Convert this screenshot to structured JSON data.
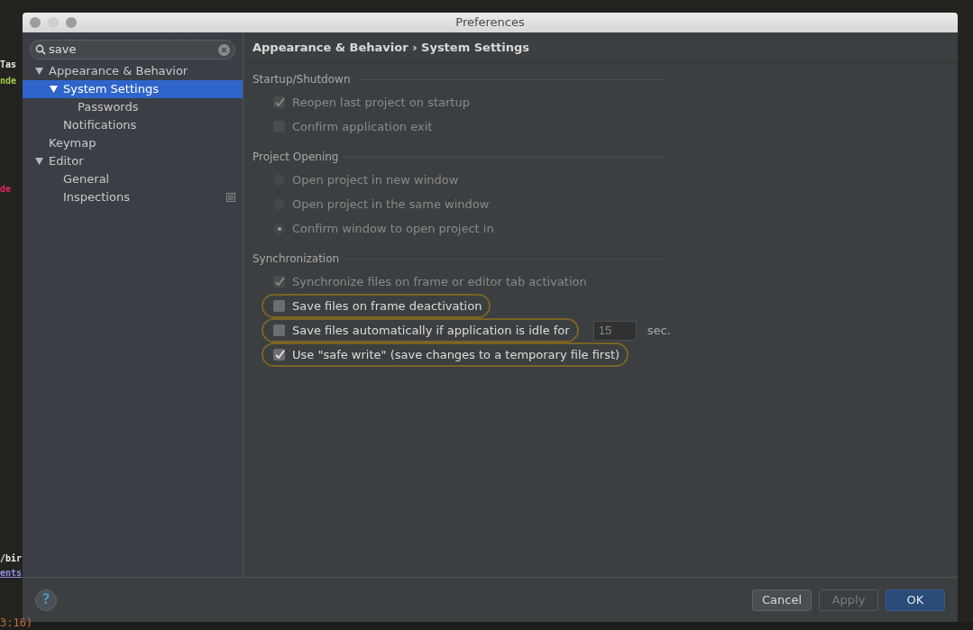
{
  "editor_fragments": [
    {
      "text": "Tas",
      "color": "#e8e8e8"
    },
    {
      "text": "nde",
      "color": "#a6c94a"
    },
    {
      "text": "de",
      "color": "#e0245e"
    },
    {
      "text": "/bir",
      "color": "#e8e8e8"
    },
    {
      "text": "ents",
      "color": "#8f8fe8"
    }
  ],
  "editor_status": "3:16)",
  "help_button": "?",
  "window": {
    "title": "Preferences"
  },
  "search": {
    "value": "save"
  },
  "sidebar": {
    "items": [
      {
        "label": "Appearance & Behavior",
        "expanded": true,
        "selected": false,
        "children": [
          {
            "label": "System Settings",
            "expanded": true,
            "selected": true,
            "children": [
              {
                "label": "Passwords",
                "selected": false
              }
            ]
          },
          {
            "label": "Notifications",
            "selected": false
          }
        ]
      },
      {
        "label": "Keymap",
        "selected": false
      },
      {
        "label": "Editor",
        "expanded": true,
        "selected": false,
        "children": [
          {
            "label": "General",
            "selected": false
          },
          {
            "label": "Inspections",
            "selected": false,
            "project_level": true
          }
        ]
      }
    ]
  },
  "breadcrumb": "Appearance & Behavior › System Settings",
  "sections": [
    {
      "title": "Startup/Shutdown",
      "options": [
        {
          "kind": "checkbox",
          "label": "Reopen last project on startup",
          "checked": true,
          "disabled": true,
          "highlighted": false
        },
        {
          "kind": "checkbox",
          "label": "Confirm application exit",
          "checked": false,
          "disabled": true,
          "highlighted": false
        }
      ]
    },
    {
      "title": "Project Opening",
      "options": [
        {
          "kind": "radio",
          "label": "Open project in new window",
          "selected": false,
          "disabled": true,
          "highlighted": false
        },
        {
          "kind": "radio",
          "label": "Open project in the same window",
          "selected": false,
          "disabled": true,
          "highlighted": false
        },
        {
          "kind": "radio",
          "label": "Confirm window to open project in",
          "selected": true,
          "disabled": true,
          "highlighted": false
        }
      ]
    },
    {
      "title": "Synchronization",
      "options": [
        {
          "kind": "checkbox",
          "label": "Synchronize files on frame or editor tab activation",
          "checked": true,
          "disabled": true,
          "highlighted": false
        },
        {
          "kind": "checkbox",
          "label": "Save files on frame deactivation",
          "checked": false,
          "disabled": false,
          "highlighted": true
        },
        {
          "kind": "checkbox",
          "label": "Save files automatically if application is idle for",
          "checked": false,
          "disabled": false,
          "highlighted": true,
          "field_value": "15",
          "unit": "sec."
        },
        {
          "kind": "checkbox",
          "label": "Use \"safe write\" (save changes to a temporary file first)",
          "checked": true,
          "disabled": false,
          "highlighted": true
        }
      ]
    }
  ],
  "buttons": [
    {
      "label": "Cancel",
      "kind": "normal",
      "disabled": false
    },
    {
      "label": "Apply",
      "kind": "normal",
      "disabled": true
    },
    {
      "label": "OK",
      "kind": "default",
      "disabled": false
    }
  ]
}
